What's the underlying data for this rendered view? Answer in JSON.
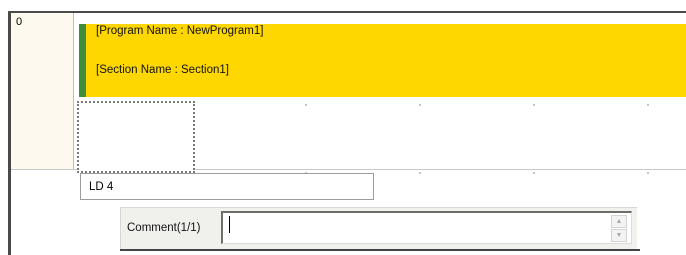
{
  "rung": {
    "number": "0"
  },
  "header": {
    "program_name": "[Program Name : NewProgram1]",
    "section_name": "[Section Name : Section1]"
  },
  "mnemonic": {
    "value": "LD 4"
  },
  "comment": {
    "label": "Comment(1/1)",
    "value": ""
  },
  "icons": {
    "spin_up": "spin-up-arrow-icon",
    "spin_down": "spin-down-arrow-icon"
  },
  "colors": {
    "header_background": "#ffd700",
    "header_stripe": "#3f8f3a",
    "rung_column": "#fdf9ee"
  }
}
